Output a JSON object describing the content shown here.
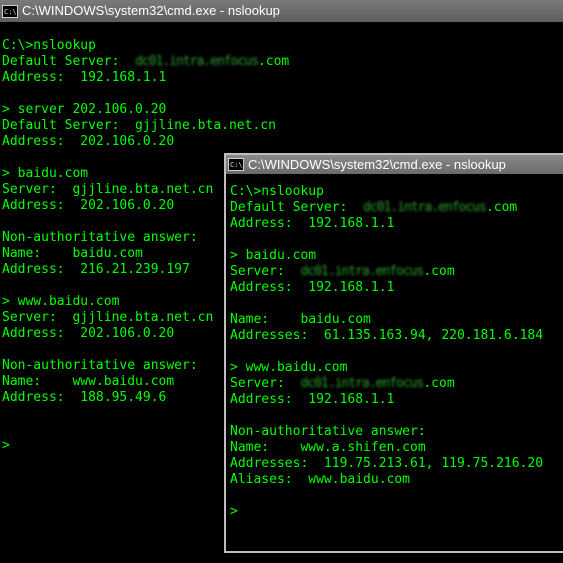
{
  "window1": {
    "title": "C:\\WINDOWS\\system32\\cmd.exe - nslookup",
    "icon_text": "C:\\",
    "lines": [
      {
        "t": "C:\\>nslookup"
      },
      {
        "t": "Default Server:  ",
        "blur": "dc01.intra.enfocus",
        "after": ".com"
      },
      {
        "t": "Address:  192.168.1.1"
      },
      {
        "t": ""
      },
      {
        "t": "> server 202.106.0.20"
      },
      {
        "t": "Default Server:  gjjline.bta.net.cn"
      },
      {
        "t": "Address:  202.106.0.20"
      },
      {
        "t": ""
      },
      {
        "t": "> baidu.com"
      },
      {
        "t": "Server:  gjjline.bta.net.cn"
      },
      {
        "t": "Address:  202.106.0.20"
      },
      {
        "t": ""
      },
      {
        "t": "Non-authoritative answer:"
      },
      {
        "t": "Name:    baidu.com"
      },
      {
        "t": "Address:  216.21.239.197"
      },
      {
        "t": ""
      },
      {
        "t": "> www.baidu.com"
      },
      {
        "t": "Server:  gjjline.bta.net.cn"
      },
      {
        "t": "Address:  202.106.0.20"
      },
      {
        "t": ""
      },
      {
        "t": "Non-authoritative answer:"
      },
      {
        "t": "Name:    www.baidu.com"
      },
      {
        "t": "Address:  188.95.49.6"
      },
      {
        "t": ""
      },
      {
        "t": ""
      },
      {
        "t": ">"
      }
    ]
  },
  "window2": {
    "title": "C:\\WINDOWS\\system32\\cmd.exe - nslookup",
    "icon_text": "C:\\",
    "lines": [
      {
        "t": "C:\\>nslookup"
      },
      {
        "t": "Default Server:  ",
        "blur": "dc01.intra.enfocus",
        "after": ".com"
      },
      {
        "t": "Address:  192.168.1.1"
      },
      {
        "t": ""
      },
      {
        "t": "> baidu.com"
      },
      {
        "t": "Server:  ",
        "blur": "dc01.intra.enfocus",
        "after": ".com"
      },
      {
        "t": "Address:  192.168.1.1"
      },
      {
        "t": ""
      },
      {
        "t": "Name:    baidu.com"
      },
      {
        "t": "Addresses:  61.135.163.94, 220.181.6.184"
      },
      {
        "t": ""
      },
      {
        "t": "> www.baidu.com"
      },
      {
        "t": "Server:  ",
        "blur": "dc01.intra.enfocus",
        "after": ".com"
      },
      {
        "t": "Address:  192.168.1.1"
      },
      {
        "t": ""
      },
      {
        "t": "Non-authoritative answer:"
      },
      {
        "t": "Name:    www.a.shifen.com"
      },
      {
        "t": "Addresses:  119.75.213.61, 119.75.216.20"
      },
      {
        "t": "Aliases:  www.baidu.com"
      },
      {
        "t": ""
      },
      {
        "t": ">"
      }
    ]
  },
  "colors": {
    "console_text": "#00ff00",
    "console_bg": "#000000",
    "titlebar": "#6e6e6e"
  }
}
